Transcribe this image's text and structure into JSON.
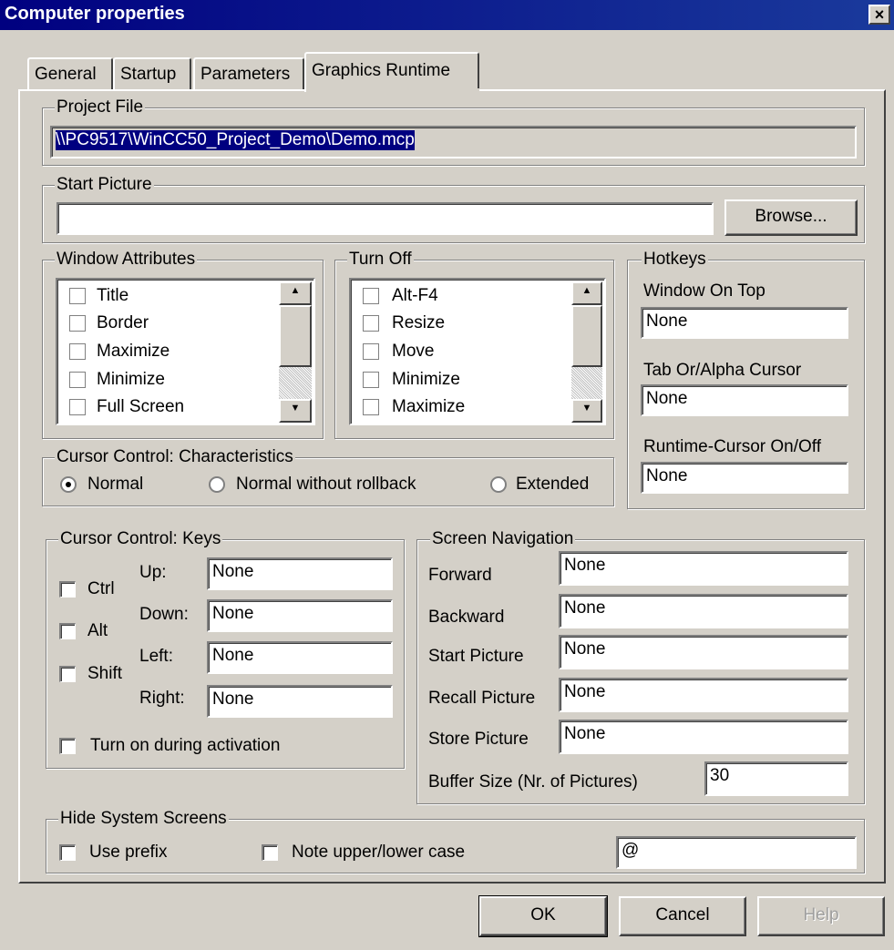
{
  "window": {
    "title": "Computer properties",
    "close_glyph": "×"
  },
  "tabs": [
    {
      "label": "General"
    },
    {
      "label": "Startup"
    },
    {
      "label": "Parameters"
    },
    {
      "label": "Graphics Runtime",
      "active": true
    }
  ],
  "project_file": {
    "legend": "Project File",
    "value": "\\\\PC9517\\WinCC50_Project_Demo\\Demo.mcp"
  },
  "start_picture": {
    "legend": "Start Picture",
    "value": "",
    "browse_label": "Browse..."
  },
  "window_attributes": {
    "legend": "Window Attributes",
    "items": [
      {
        "label": "Title",
        "checked": false
      },
      {
        "label": "Border",
        "checked": false
      },
      {
        "label": "Maximize",
        "checked": false
      },
      {
        "label": "Minimize",
        "checked": false
      },
      {
        "label": "Full Screen",
        "checked": false
      }
    ]
  },
  "turn_off": {
    "legend": "Turn Off",
    "items": [
      {
        "label": "Alt-F4",
        "checked": false
      },
      {
        "label": "Resize",
        "checked": false
      },
      {
        "label": "Move",
        "checked": false
      },
      {
        "label": "Minimize",
        "checked": false
      },
      {
        "label": "Maximize",
        "checked": false
      }
    ]
  },
  "hotkeys": {
    "legend": "Hotkeys",
    "window_on_top": {
      "label": "Window On Top",
      "value": "None"
    },
    "tab_alpha_cursor": {
      "label": "Tab Or/Alpha Cursor",
      "value": "None"
    },
    "runtime_cursor": {
      "label": "Runtime-Cursor On/Off",
      "value": "None"
    }
  },
  "cursor_characteristics": {
    "legend": "Cursor Control: Characteristics",
    "options": [
      {
        "label": "Normal",
        "selected": true
      },
      {
        "label": "Normal without rollback",
        "selected": false
      },
      {
        "label": "Extended",
        "selected": false
      }
    ]
  },
  "cursor_keys": {
    "legend": "Cursor Control: Keys",
    "modifiers": [
      {
        "label": "Ctrl",
        "checked": false
      },
      {
        "label": "Alt",
        "checked": false
      },
      {
        "label": "Shift",
        "checked": false
      }
    ],
    "keys": [
      {
        "label": "Up:",
        "value": "None"
      },
      {
        "label": "Down:",
        "value": "None"
      },
      {
        "label": "Left:",
        "value": "None"
      },
      {
        "label": "Right:",
        "value": "None"
      }
    ],
    "turn_on_activation": {
      "label": "Turn on during activation",
      "checked": false
    }
  },
  "screen_navigation": {
    "legend": "Screen Navigation",
    "fields": [
      {
        "label": "Forward",
        "value": "None"
      },
      {
        "label": "Backward",
        "value": "None"
      },
      {
        "label": "Start Picture",
        "value": "None"
      },
      {
        "label": "Recall Picture",
        "value": "None"
      },
      {
        "label": "Store Picture",
        "value": "None"
      }
    ],
    "buffer_size": {
      "label": "Buffer Size (Nr. of Pictures)",
      "value": "30"
    }
  },
  "hide_system_screens": {
    "legend": "Hide System Screens",
    "use_prefix": {
      "label": "Use prefix",
      "checked": false
    },
    "note_case": {
      "label": "Note upper/lower case",
      "checked": false
    },
    "prefix_value": "@"
  },
  "buttons": {
    "ok": "OK",
    "cancel": "Cancel",
    "help": "Help"
  }
}
